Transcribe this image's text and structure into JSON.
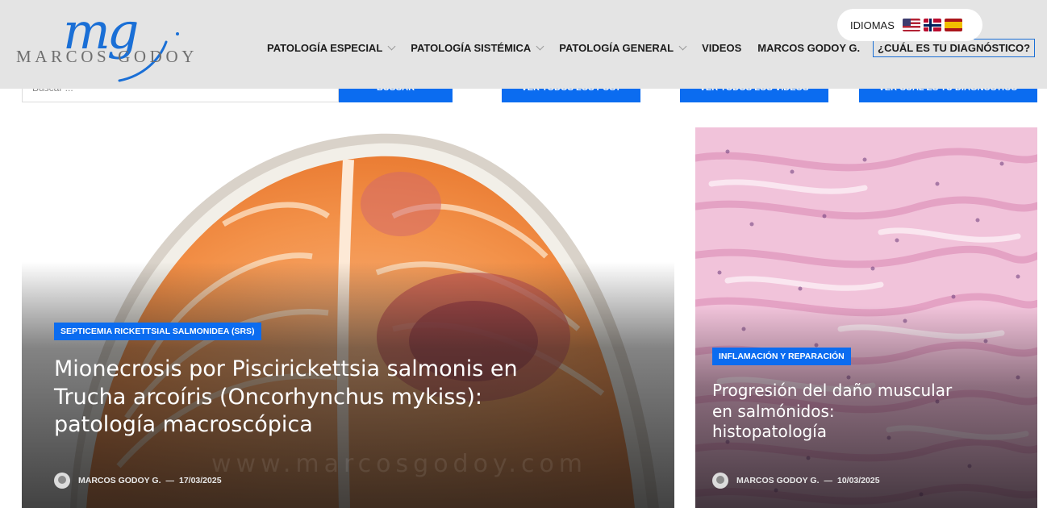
{
  "header": {
    "logo": {
      "monogram": "mg",
      "wordmark": "MARCOS GODOY"
    },
    "nav": [
      {
        "label": "PATOLOGÍA ESPECIAL",
        "has_dropdown": true
      },
      {
        "label": "PATOLOGÍA SISTÉMICA",
        "has_dropdown": true
      },
      {
        "label": "PATOLOGÍA GENERAL",
        "has_dropdown": true
      },
      {
        "label": "VIDEOS",
        "has_dropdown": false
      },
      {
        "label": "MARCOS GODOY G.",
        "has_dropdown": false
      },
      {
        "label": "¿CUÁL ES TU DIAGNÓSTICO?",
        "has_dropdown": false
      }
    ],
    "languages": {
      "label": "IDIOMAS",
      "flags": [
        "us-flag-icon",
        "norway-flag-icon",
        "spain-flag-icon"
      ]
    }
  },
  "search": {
    "placeholder": "Buscar ...",
    "button_label": "BUSCAR"
  },
  "buttons": [
    {
      "label": "VER TODOS LOS POST"
    },
    {
      "label": "VER TODOS LOS VIDEOS"
    },
    {
      "label": "VER CUÁL ES TU DIAGNÓSTICO"
    }
  ],
  "posts": {
    "main": {
      "category": "SEPTICEMIA RICKETTSIAL SALMONIDEA (SRS)",
      "title": "Mionecrosis por Piscirickettsia salmonis en Trucha arcoíris (Oncorhynchus mykiss): patología macroscópica",
      "author": "MARCOS GODOY G.",
      "separator": "—",
      "date": "17/03/2025",
      "watermark": "www.marcosgodoy.com"
    },
    "side": {
      "category": "INFLAMACIÓN Y REPARACIÓN",
      "title": "Progresión del daño muscular en salmónidos: histopatología",
      "author": "MARCOS GODOY G.",
      "separator": "—",
      "date": "10/03/2025"
    }
  },
  "colors": {
    "accent": "#0b6cf0",
    "header_bg": "#e4e4e4",
    "logo_blue": "#1a6fd6"
  }
}
